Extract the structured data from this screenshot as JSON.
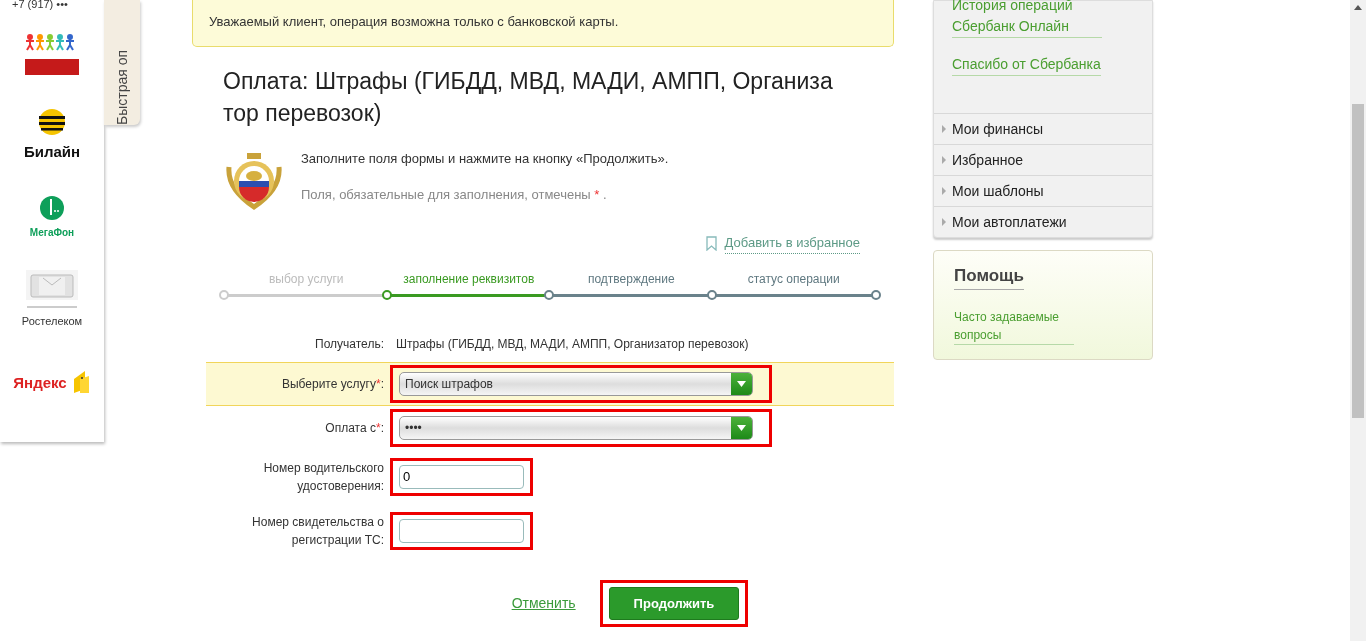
{
  "phone_fragment": "+7 (917) •••",
  "providers": [
    {
      "kind": "people"
    },
    {
      "kind": "beeline",
      "label": "Билайн"
    },
    {
      "kind": "megafon",
      "label": "МегаФон"
    },
    {
      "kind": "rostelecom",
      "label": "Ростелеком"
    },
    {
      "kind": "yandex",
      "label": "Яндекс"
    }
  ],
  "quick_tab": {
    "label": "Быстрая оп"
  },
  "notice": "Уважаемый клиент, операция возможна только с банковской карты.",
  "title": "Оплата: Штрафы (ГИБДД, МВД, МАДИ, АМПП, Организа тор перевозок)",
  "intro": {
    "instruction": "Заполните поля формы и нажмите на кнопку «Продолжить».",
    "required_note": "Поля, обязательные для заполнения, отмечены",
    "required_mark": "*",
    "required_end": "."
  },
  "favorite_link": "Добавить в избранное",
  "steps": [
    {
      "label": "выбор услуги",
      "completed": true,
      "selected": false
    },
    {
      "label": "заполнение реквизитов",
      "completed": false,
      "selected": true
    },
    {
      "label": "подтверждение",
      "completed": false,
      "selected": false
    },
    {
      "label": "статус операции",
      "completed": false,
      "selected": false
    }
  ],
  "recipient": {
    "label": "Получатель:",
    "value": "Штрафы (ГИБДД, МВД, МАДИ, АМПП, Организатор перевозок)"
  },
  "fields": [
    {
      "kind": "select",
      "label": "Выберите услугу",
      "required": true,
      "label_end": ":",
      "value": "Поиск штрафов",
      "highlighted": true,
      "annotated": true
    },
    {
      "kind": "select",
      "label": "Оплата с",
      "required": true,
      "label_end": ":",
      "value": "••••",
      "highlighted": false,
      "annotated": true
    },
    {
      "kind": "text",
      "label": "Номер водительского удостоверения:",
      "required": false,
      "value": "0",
      "highlighted": false,
      "annotated": true
    },
    {
      "kind": "text",
      "label": "Номер свидетельства о регистрации ТС:",
      "required": false,
      "highlighted": false,
      "annotated": true
    }
  ],
  "actions": {
    "cancel": "Отменить",
    "submit": "Продолжить",
    "submit_annotated": true
  },
  "sidebar": {
    "links": [
      "История операций Сбербанк Онлайн",
      "Спасибо от Сбербанка"
    ],
    "menu": [
      "Мои финансы",
      "Избранное",
      "Мои шаблоны",
      "Мои автоплатежи"
    ],
    "help": {
      "title": "Помощь",
      "links": [
        "Часто задаваемые вопросы"
      ]
    }
  }
}
